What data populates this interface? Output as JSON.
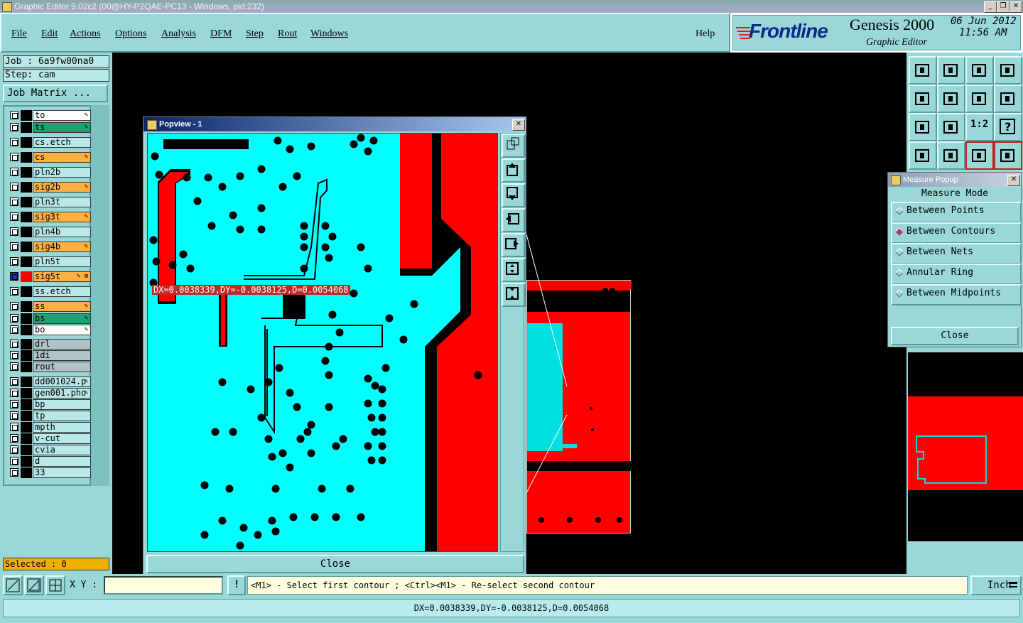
{
  "window": {
    "title": "Graphic Editor 9.02c2 (00@HY-P2QAE-PC13 - Windows, pid:232)"
  },
  "menu": {
    "items": [
      "File",
      "Edit",
      "Actions",
      "Options",
      "Analysis",
      "DFM",
      "Step",
      "Rout",
      "Windows"
    ],
    "help": "Help"
  },
  "brand": {
    "logo": "Frontline",
    "product": "Genesis 2000",
    "subtitle": "Graphic Editor",
    "date": "06 Jun 2012",
    "time": "11:56 AM"
  },
  "job": {
    "job_label": "Job  : 6a9fw00na0",
    "step_label": "Step: cam",
    "matrix_button": "Job Matrix ..."
  },
  "layers": [
    {
      "name": "to",
      "color": "#ffffff",
      "mark": "✎"
    },
    {
      "name": "ts",
      "color": "#20a070",
      "mark": "✎"
    },
    {
      "name": "cs.etch",
      "color": "#b8e8e8",
      "mark": ""
    },
    {
      "name": "cs",
      "color": "#ffb040",
      "mark": "✎"
    },
    {
      "name": "pln2b",
      "color": "#b8e8e8",
      "mark": ""
    },
    {
      "name": "sig2b",
      "color": "#ffb040",
      "mark": "✎"
    },
    {
      "name": "pln3t",
      "color": "#b8e8e8",
      "mark": ""
    },
    {
      "name": "sig3t",
      "color": "#ffb040",
      "mark": "✎"
    },
    {
      "name": "pln4b",
      "color": "#b8e8e8",
      "mark": ""
    },
    {
      "name": "sig4b",
      "color": "#ffb040",
      "mark": "✎"
    },
    {
      "name": "pln5t",
      "color": "#b8e8e8",
      "mark": ""
    },
    {
      "name": "sig5t",
      "color": "#ffb040",
      "mark": "✎ ⊞"
    },
    {
      "name": "ss.etch",
      "color": "#b8e8e8",
      "mark": ""
    },
    {
      "name": "ss",
      "color": "#ffb040",
      "mark": "✎"
    },
    {
      "name": "bs",
      "color": "#20a070",
      "mark": "✎"
    },
    {
      "name": "bo",
      "color": "#ffffff",
      "mark": "✎"
    },
    {
      "name": "drl",
      "color": "#b0c4c8",
      "mark": ""
    },
    {
      "name": "1di",
      "color": "#b0c4c8",
      "mark": ""
    },
    {
      "name": "rout",
      "color": "#b0c4c8",
      "mark": ""
    },
    {
      "name": "dd001024.p",
      "color": "#b8e8e8",
      "mark": "✎"
    },
    {
      "name": "gen001.pho",
      "color": "#b8e8e8",
      "mark": "✎"
    },
    {
      "name": "bp",
      "color": "#b8e8e8",
      "mark": ""
    },
    {
      "name": "tp",
      "color": "#b8e8e8",
      "mark": ""
    },
    {
      "name": "mpth",
      "color": "#b8e8e8",
      "mark": ""
    },
    {
      "name": "v-cut",
      "color": "#b8e8e8",
      "mark": ""
    },
    {
      "name": "cvia",
      "color": "#b8e8e8",
      "mark": ""
    },
    {
      "name": "d",
      "color": "#b8e8e8",
      "mark": ""
    },
    {
      "name": "33",
      "color": "#b8e8e8",
      "mark": ""
    }
  ],
  "selected": "Selected : 0",
  "popview": {
    "title": "Popview - 1",
    "measure_label": "DX=0.0038339,DY=-0.0038125,D=0.0054068",
    "close": "Close"
  },
  "measure_popup": {
    "title": "Measure Popup",
    "header": "Measure Mode",
    "modes": [
      "Between Points",
      "Between Contours",
      "Between Nets",
      "Annular Ring",
      "Between Midpoints"
    ],
    "selected_mode": "Between Contours",
    "close": "Close"
  },
  "toolbar_right": {
    "ratio_label": "1:2",
    "help_label": "?"
  },
  "command": {
    "xy_label": "X Y :",
    "xy_value": "",
    "prompt": "<M1> - Select first contour ; <Ctrl><M1> - Re-select second contour",
    "units": "Inch"
  },
  "status": {
    "text": "DX=0.0038339,DY=-0.0038125,D=0.0054068"
  },
  "colors": {
    "panel": "#9ad8d8",
    "copper": "#ff0000",
    "board": "#00ffff"
  }
}
